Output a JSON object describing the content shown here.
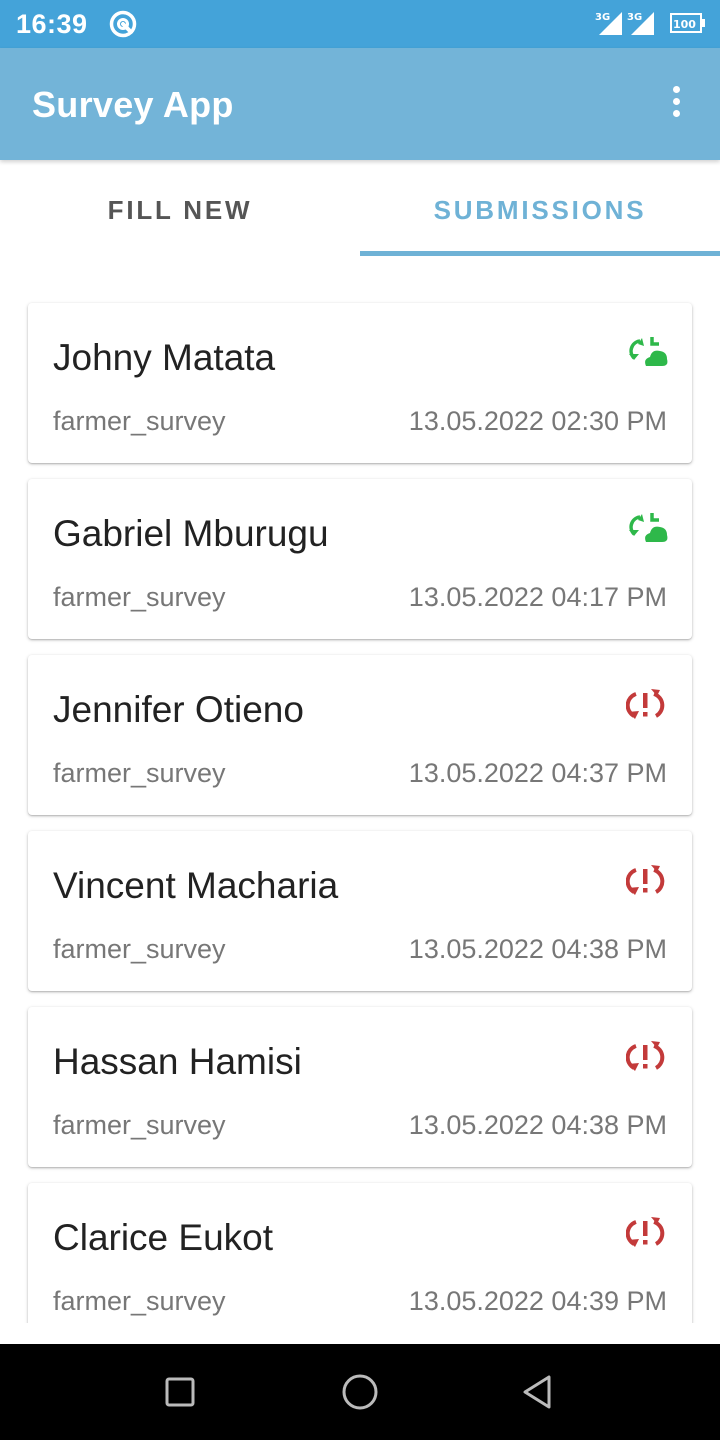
{
  "status_bar": {
    "time": "16:39",
    "network_1": "3G",
    "network_2": "3G",
    "battery": "100"
  },
  "app_bar": {
    "title": "Survey App",
    "menu_icon": "more-vert-icon"
  },
  "tabs": [
    {
      "label": "FILL NEW",
      "selected": false
    },
    {
      "label": "SUBMISSIONS",
      "selected": true
    }
  ],
  "colors": {
    "status_bar": "#44a3d9",
    "app_bar": "#73b4d8",
    "accent": "#6fb2d6",
    "synced": "#2eb84a",
    "error": "#c33a3a"
  },
  "submissions": [
    {
      "name": "Johny Matata",
      "survey": "farmer_survey",
      "date": "13.05.2022 02:30 PM",
      "status": "synced"
    },
    {
      "name": "Gabriel Mburugu",
      "survey": "farmer_survey",
      "date": "13.05.2022 04:17 PM",
      "status": "synced"
    },
    {
      "name": "Jennifer Otieno",
      "survey": "farmer_survey",
      "date": "13.05.2022 04:37 PM",
      "status": "error"
    },
    {
      "name": "Vincent Macharia",
      "survey": "farmer_survey",
      "date": "13.05.2022 04:38 PM",
      "status": "error"
    },
    {
      "name": "Hassan Hamisi",
      "survey": "farmer_survey",
      "date": "13.05.2022 04:38 PM",
      "status": "error"
    },
    {
      "name": "Clarice Eukot",
      "survey": "farmer_survey",
      "date": "13.05.2022 04:39 PM",
      "status": "error"
    }
  ],
  "nav_bar": [
    "recents-square-icon",
    "home-circle-icon",
    "back-triangle-icon"
  ]
}
